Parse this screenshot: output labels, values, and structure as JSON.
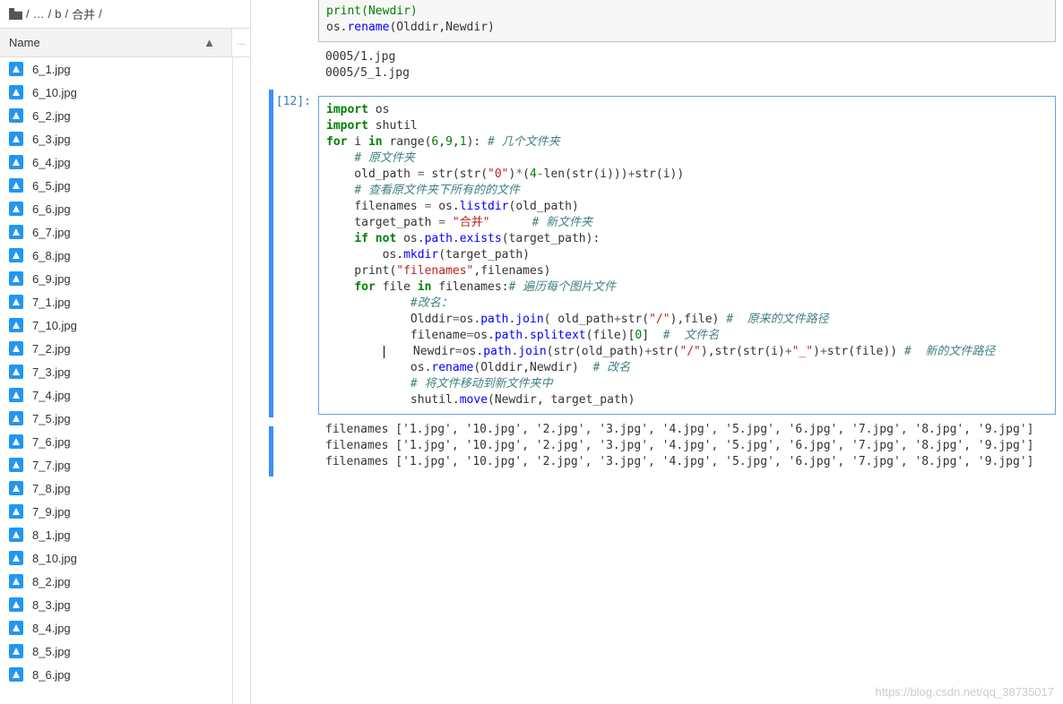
{
  "breadcrumb": {
    "sep": "/",
    "dots": "…",
    "folder1": "b",
    "folder2": "合并"
  },
  "nameHeader": {
    "label": "Name",
    "arrow": "▲"
  },
  "files": [
    "6_1.jpg",
    "6_10.jpg",
    "6_2.jpg",
    "6_3.jpg",
    "6_4.jpg",
    "6_5.jpg",
    "6_6.jpg",
    "6_7.jpg",
    "6_8.jpg",
    "6_9.jpg",
    "7_1.jpg",
    "7_10.jpg",
    "7_2.jpg",
    "7_3.jpg",
    "7_4.jpg",
    "7_5.jpg",
    "7_6.jpg",
    "7_7.jpg",
    "7_8.jpg",
    "7_9.jpg",
    "8_1.jpg",
    "8_10.jpg",
    "8_2.jpg",
    "8_3.jpg",
    "8_4.jpg",
    "8_5.jpg",
    "8_6.jpg"
  ],
  "cell_prev": {
    "code": {
      "l1": "print(Newdir)",
      "l2_a": "os.",
      "l2_b": "rename",
      "l2_c": "(Olddir,Newdir)"
    },
    "output": "0005/1.jpg\n0005/5_1.jpg"
  },
  "cell12": {
    "prompt": "[12]:",
    "output": "filenames ['1.jpg', '10.jpg', '2.jpg', '3.jpg', '4.jpg', '5.jpg', '6.jpg', '7.jpg', '8.jpg', '9.jpg']\nfilenames ['1.jpg', '10.jpg', '2.jpg', '3.jpg', '4.jpg', '5.jpg', '6.jpg', '7.jpg', '8.jpg', '9.jpg']\nfilenames ['1.jpg', '10.jpg', '2.jpg', '3.jpg', '4.jpg', '5.jpg', '6.jpg', '7.jpg', '8.jpg', '9.jpg']"
  },
  "code12": {
    "l1_a": "import",
    "l1_b": " os",
    "l2_a": "import",
    "l2_b": " shutil",
    "l3_a": "for",
    "l3_b": " i ",
    "l3_c": "in",
    "l3_d": " range(",
    "l3_e": "6",
    "l3_f": ",",
    "l3_g": "9",
    "l3_h": ",",
    "l3_i": "1",
    "l3_j": "): ",
    "l3_k": "# 几个文件夹",
    "l4": "    ",
    "l4_a": "# 原文件夹",
    "l5_a": "    old_path ",
    "l5_b": "=",
    "l5_c": " str(str(",
    "l5_d": "\"0\"",
    "l5_e": ")",
    "l5_f": "*",
    "l5_g": "(",
    "l5_h": "4",
    "l5_i": "-",
    "l5_j": "len(str(i)))",
    "l5_k": "+",
    "l5_l": "str(i))",
    "l6_a": "    ",
    "l6_b": "# 查看原文件夹下所有的的文件",
    "l7_a": "    filenames ",
    "l7_b": "=",
    "l7_c": " os.",
    "l7_d": "listdir",
    "l7_e": "(old_path)",
    "l8_a": "    target_path ",
    "l8_b": "=",
    "l8_c": " ",
    "l8_d": "\"合并\"",
    "l8_e": "      ",
    "l8_f": "# 新文件夹",
    "l9_a": "    ",
    "l9_b": "if",
    "l9_c": " ",
    "l9_d": "not",
    "l9_e": " os.",
    "l9_f": "path",
    "l9_g": ".",
    "l9_h": "exists",
    "l9_i": "(target_path):",
    "l10_a": "        os.",
    "l10_b": "mkdir",
    "l10_c": "(target_path)",
    "l11_a": "    print(",
    "l11_b": "\"filenames\"",
    "l11_c": ",filenames)",
    "l12_a": "    ",
    "l12_b": "for",
    "l12_c": " file ",
    "l12_d": "in",
    "l12_e": " filenames:",
    "l12_f": "# 遍历每个图片文件",
    "l13_a": "            ",
    "l13_b": "#改名：",
    "l14_a": "            Olddir",
    "l14_b": "=",
    "l14_c": "os.",
    "l14_d": "path",
    "l14_e": ".",
    "l14_f": "join",
    "l14_g": "( old_path",
    "l14_h": "+",
    "l14_i": "str(",
    "l14_j": "\"/\"",
    "l14_k": "),file) ",
    "l14_l": "#  原来的文件路径",
    "l15_a": "            filename",
    "l15_b": "=",
    "l15_c": "os.",
    "l15_d": "path",
    "l15_e": ".",
    "l15_f": "splitext",
    "l15_g": "(file)[",
    "l15_h": "0",
    "l15_i": "]  ",
    "l15_j": "#  文件名",
    "l16_a": "        ",
    "l16_b": "    Newdir",
    "l16_c": "=",
    "l16_d": "os.",
    "l16_e": "path",
    "l16_f": ".",
    "l16_g": "join",
    "l16_h": "(str(old_path)",
    "l16_i": "+",
    "l16_j": "str(",
    "l16_k": "\"/\"",
    "l16_l": "),str(str(i)",
    "l16_m": "+",
    "l16_n": "\"_\"",
    "l16_o": ")",
    "l16_p": "+",
    "l16_q": "str(file)) ",
    "l16_r": "#  新的文件路径",
    "l17_a": "            os.",
    "l17_b": "rename",
    "l17_c": "(Olddir,Newdir)  ",
    "l17_d": "# 改名",
    "l18_a": "            ",
    "l18_b": "# 将文件移动到新文件夹中",
    "l19_a": "            shutil.",
    "l19_b": "move",
    "l19_c": "(Newdir, target_path)"
  },
  "watermark": "https://blog.csdn.net/qq_38735017"
}
